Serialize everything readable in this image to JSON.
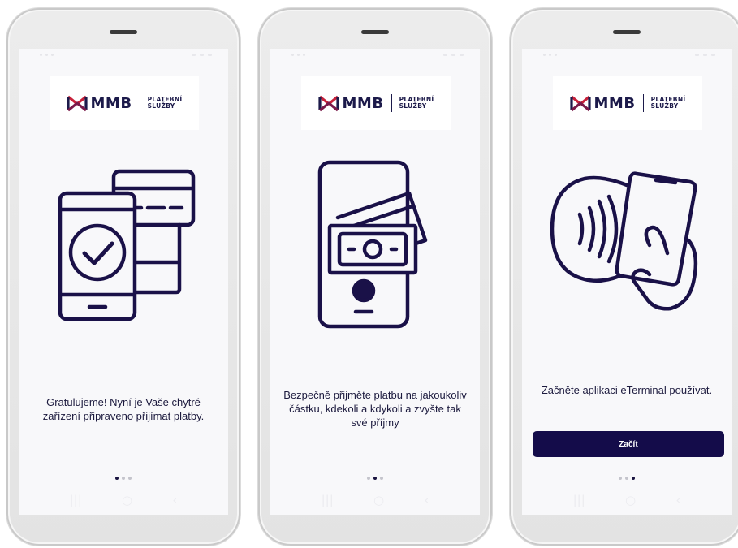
{
  "brand": {
    "name": "MMB",
    "sub_line1": "PLATEBNÍ",
    "sub_line2": "SLUŽBY",
    "colors": {
      "primary": "#1c1a4a",
      "accent": "#c8213a",
      "button": "#140c4a"
    }
  },
  "screens": [
    {
      "illustration": "phone-card-check-icon",
      "message": "Gratulujeme! Nyní je Vaše chytré zařízení připraveno přijímat platby.",
      "active_page": 1
    },
    {
      "illustration": "phone-banknote-icon",
      "message": "Bezpečně přijměte platbu na jakoukoliv částku, kdekoli a kdykoli a zvyšte tak své příjmy",
      "active_page": 2
    },
    {
      "illustration": "contactless-hand-phone-icon",
      "message": "Začněte aplikaci eTerminal používat.",
      "button_label": "Začít",
      "active_page": 3
    }
  ],
  "navbar": {
    "recent": "|||",
    "home": "○",
    "back": "‹"
  }
}
